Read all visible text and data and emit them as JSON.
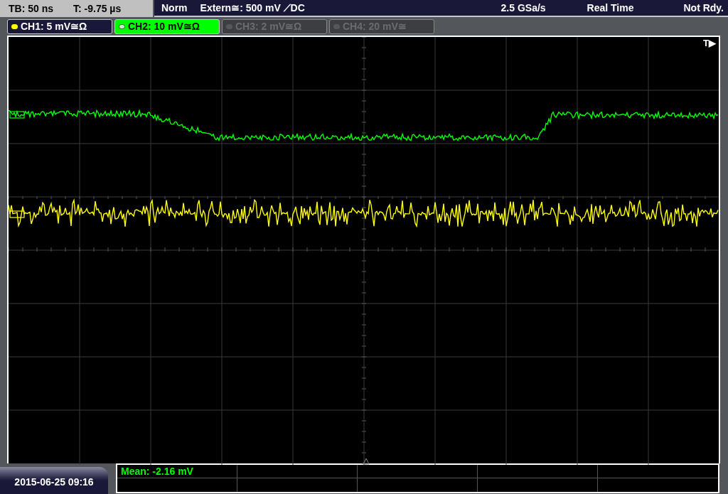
{
  "status_bar": {
    "timebase": "TB: 50 ns",
    "trigger_time": "T: -9.75 µs",
    "trigger_mode": "Norm",
    "trigger_source": "Extern≅: 500 mV ⟋DC",
    "sample_rate": "2.5 GSa/s",
    "acquisition": "Real Time",
    "state": "Not Rdy."
  },
  "channels": [
    {
      "label": "CH1: 5 mV≅Ω",
      "on": true,
      "selected": false,
      "color": "#ffff00"
    },
    {
      "label": "CH2: 10 mV≅Ω",
      "on": true,
      "selected": true,
      "color": "#00ff00"
    },
    {
      "label": "CH3: 2 mV≅Ω",
      "on": false,
      "selected": false
    },
    {
      "label": "CH4: 20 mV≅",
      "on": false,
      "selected": false
    }
  ],
  "trigger_marker": "T▶",
  "date_time": "2015-06-25 09:16",
  "measurements": [
    {
      "text": "Mean: -2.16 mV"
    }
  ]
}
